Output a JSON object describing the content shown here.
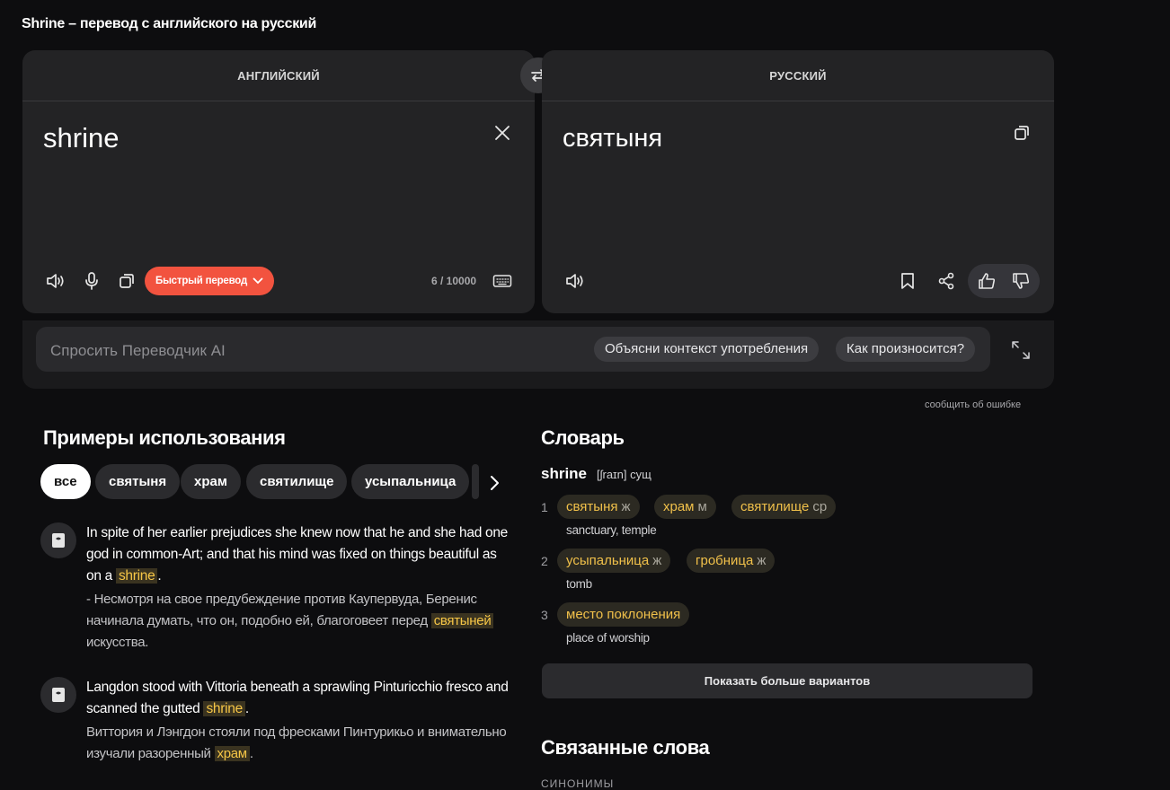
{
  "page": {
    "title": "Shrine – перевод с английского на русский"
  },
  "source": {
    "lang_label": "АНГЛИЙСКИЙ",
    "text": "shrine",
    "fast_translation_label": "Быстрый перевод",
    "counter": "6 / 10000"
  },
  "target": {
    "lang_label": "РУССКИЙ",
    "text": "святыня"
  },
  "ai": {
    "placeholder": "Спросить Переводчик AI",
    "chips": [
      "Объясни контекст употребления",
      "Как произносится?"
    ]
  },
  "report_error": "сообщить об ошибке",
  "examples": {
    "title": "Примеры использования",
    "filters": [
      "все",
      "святыня",
      "храм",
      "святилище",
      "усыпальница"
    ],
    "items": [
      {
        "en_before": "In spite of her earlier prejudices she knew now that he and she had one god in common-Art; and that his mind was fixed on things beautiful as on a ",
        "en_hl": "shrine",
        "en_after": ".",
        "ru_before": "- Несмотря на свое предубеждение против Каупервуда, Беренис начинала думать, что он, подобно ей, благоговеет перед ",
        "ru_hl": "святыней",
        "ru_after": " искусства."
      },
      {
        "en_before": "Langdon stood with Vittoria beneath a sprawling Pinturicchio fresco and scanned the gutted ",
        "en_hl": "shrine",
        "en_after": ".",
        "ru_before": "Виттория и Лэнгдон стояли под фресками Пинтурикьо и внимательно изучали разоренный ",
        "ru_hl": "храм",
        "ru_after": "."
      }
    ]
  },
  "dictionary": {
    "title": "Словарь",
    "headword": "shrine",
    "transcription": "[ʃraɪn] сущ",
    "senses": [
      {
        "num": "1",
        "tags": [
          {
            "word": "святыня",
            "g": "ж"
          },
          {
            "word": "храм",
            "g": "м"
          },
          {
            "word": "святилище",
            "g": "ср"
          }
        ],
        "en": "sanctuary, temple"
      },
      {
        "num": "2",
        "tags": [
          {
            "word": "усыпальница",
            "g": "ж"
          },
          {
            "word": "гробница",
            "g": "ж"
          }
        ],
        "en": "tomb"
      },
      {
        "num": "3",
        "tags": [
          {
            "word": "место поклонения",
            "g": ""
          }
        ],
        "en": "place of worship"
      }
    ],
    "more_button": "Показать больше вариантов"
  },
  "related": {
    "title": "Связанные слова",
    "label": "СИНОНИМЫ"
  }
}
